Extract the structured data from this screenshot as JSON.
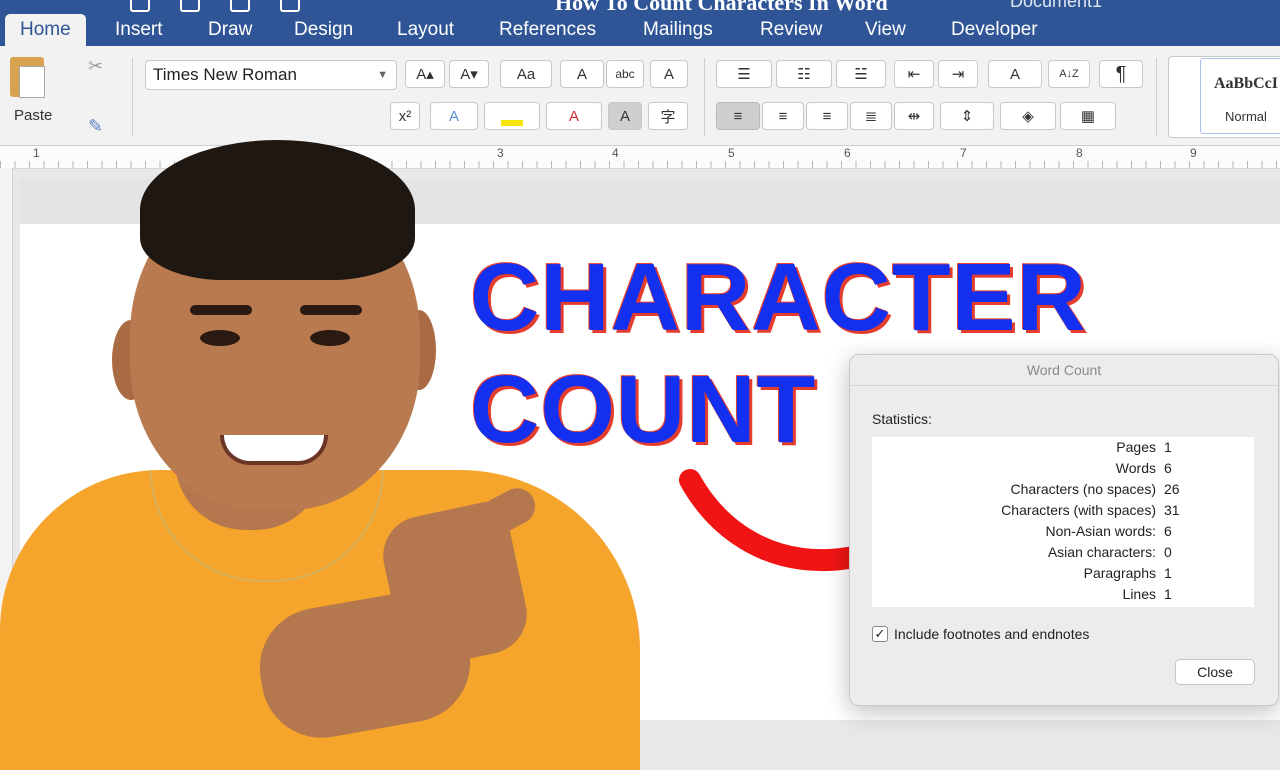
{
  "titlebar": {
    "doc_title": "How To Count Characters In Word",
    "doc_name": "Document1"
  },
  "tabs": [
    {
      "label": "Home"
    },
    {
      "label": "Insert"
    },
    {
      "label": "Draw"
    },
    {
      "label": "Design"
    },
    {
      "label": "Layout"
    },
    {
      "label": "References"
    },
    {
      "label": "Mailings"
    },
    {
      "label": "Review"
    },
    {
      "label": "View"
    },
    {
      "label": "Developer"
    }
  ],
  "ribbon": {
    "paste_label": "Paste",
    "font_name": "Times New Roman",
    "style_sample": "AaBbCcI",
    "style_name": "Normal",
    "glyphs": {
      "grow": "A▴",
      "shrink": "A▾",
      "case": "Aa",
      "clear": "A",
      "abc": "abc",
      "box_a": "A",
      "sup": "x²",
      "effects": "A",
      "font_color": "A",
      "shade": "A",
      "enclose": "字",
      "pilcrow": "¶",
      "sort": "A↓Z"
    }
  },
  "ruler": {
    "labels": [
      "1",
      "3",
      "4",
      "5",
      "6",
      "7",
      "8",
      "9"
    ]
  },
  "headline": {
    "line1": "CHARACTER",
    "line2": "COUNT"
  },
  "dialog": {
    "title": "Word Count",
    "statistics_label": "Statistics:",
    "rows": [
      {
        "label": "Pages",
        "value": "1"
      },
      {
        "label": "Words",
        "value": "6"
      },
      {
        "label": "Characters (no spaces)",
        "value": "26"
      },
      {
        "label": "Characters (with spaces)",
        "value": "31"
      },
      {
        "label": "Non-Asian words:",
        "value": "6"
      },
      {
        "label": "Asian characters:",
        "value": "0"
      },
      {
        "label": "Paragraphs",
        "value": "1"
      },
      {
        "label": "Lines",
        "value": "1"
      }
    ],
    "include_footnotes_label": "Include footnotes and endnotes",
    "include_footnotes_checked": "✓",
    "close_label": "Close"
  },
  "colors": {
    "ribbon_blue": "#2f5596",
    "headline_blue": "#1330f0",
    "headline_outline": "#e43d2e",
    "arrow_red": "#f01414",
    "shirt": "#f5a52c"
  }
}
